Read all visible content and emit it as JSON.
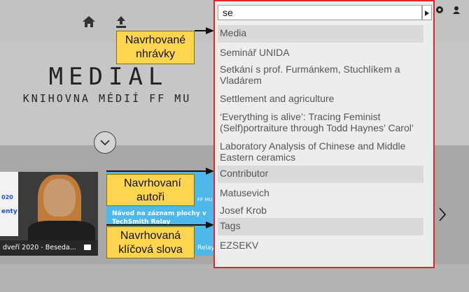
{
  "search": {
    "value": "se"
  },
  "hero": {
    "title": "MEDIAL",
    "subtitle": "KNIHOVNA MÉDIÍ FF MU"
  },
  "autocomplete": {
    "groups": [
      {
        "header": "Media",
        "items": [
          "Seminář UNIDA",
          "Setkání s prof. Furmánkem, Stuchlíkem a Vladárem",
          "Settlement and agriculture",
          "‘Everything is alive’: Tracing Feminist (Self)portraiture through Todd Haynes’ Carol’",
          "Laboratory Analysis of Chinese and Middle Eastern ceramics"
        ]
      },
      {
        "header": "Contributor",
        "items": [
          "Matusevich",
          "Josef Krob"
        ]
      },
      {
        "header": "Tags",
        "items": [
          "EZSEKV"
        ]
      }
    ]
  },
  "callouts": {
    "media": "Navrhované nhrávky",
    "authors": "Navrhovaní autoři",
    "tags": "Navrhovaná klíčová slova"
  },
  "cards": {
    "card1": {
      "caption": "dveří 2020 - Beseda...",
      "side_top": "020",
      "side_mid": "enty"
    },
    "card2": {
      "text": "Návod na záznam plochy v TechSmith Relay",
      "badge": "FF MU",
      "relay": "Relay"
    }
  },
  "icons": [
    "home-icon",
    "upload-icon",
    "settings-icon",
    "user-icon",
    "chevron-down-icon",
    "chevron-right-icon",
    "video-camera-icon"
  ],
  "colors": {
    "highlight_border": "#e0262a",
    "callout_fill": "#ffd54f",
    "card_blue": "#4fb8ea"
  }
}
